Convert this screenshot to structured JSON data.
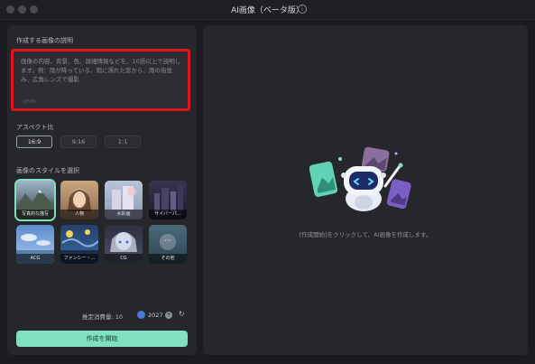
{
  "window": {
    "title": "AI画像（ベータ版）",
    "info_icon": "info-icon",
    "info_glyph": "i"
  },
  "left_panel": {
    "description_label": "作成する画像の説明",
    "description_placeholder": "画像の内容、背景、色、詳細情報などを、10語以上で説明します。例：雨が降っている、雨に濡れた窓から、雨の街並み、広角レンズで撮影",
    "description_counter": "0/500",
    "aspect_label": "アスペクト比",
    "aspect_options": [
      "16:9",
      "9:16",
      "1:1"
    ],
    "aspect_selected": "16:9",
    "style_label": "画像のスタイルを選択",
    "styles": [
      "写真的な描写",
      "人物",
      "水彩画",
      "サイバーパ...",
      "ACG",
      "ファンシー・...",
      "CG",
      "その他"
    ],
    "style_selected": "写真的な描写",
    "credits_label": "推定消費量: 10",
    "coin_value": "2027",
    "coin_add_icon": "plus-icon",
    "coin_add_glyph": "+",
    "refresh_icon": "refresh-icon",
    "refresh_glyph": "↻",
    "generate_button": "作成を開始"
  },
  "right_panel": {
    "illustration": "robot-mascot-illustration",
    "hint": "[作成開始]をクリックして、AI画像を作成します。"
  },
  "colors": {
    "accent": "#7fe0c2",
    "highlight_border": "#e0141c",
    "panel_bg": "#26272b",
    "app_bg": "#1b1c1f"
  }
}
